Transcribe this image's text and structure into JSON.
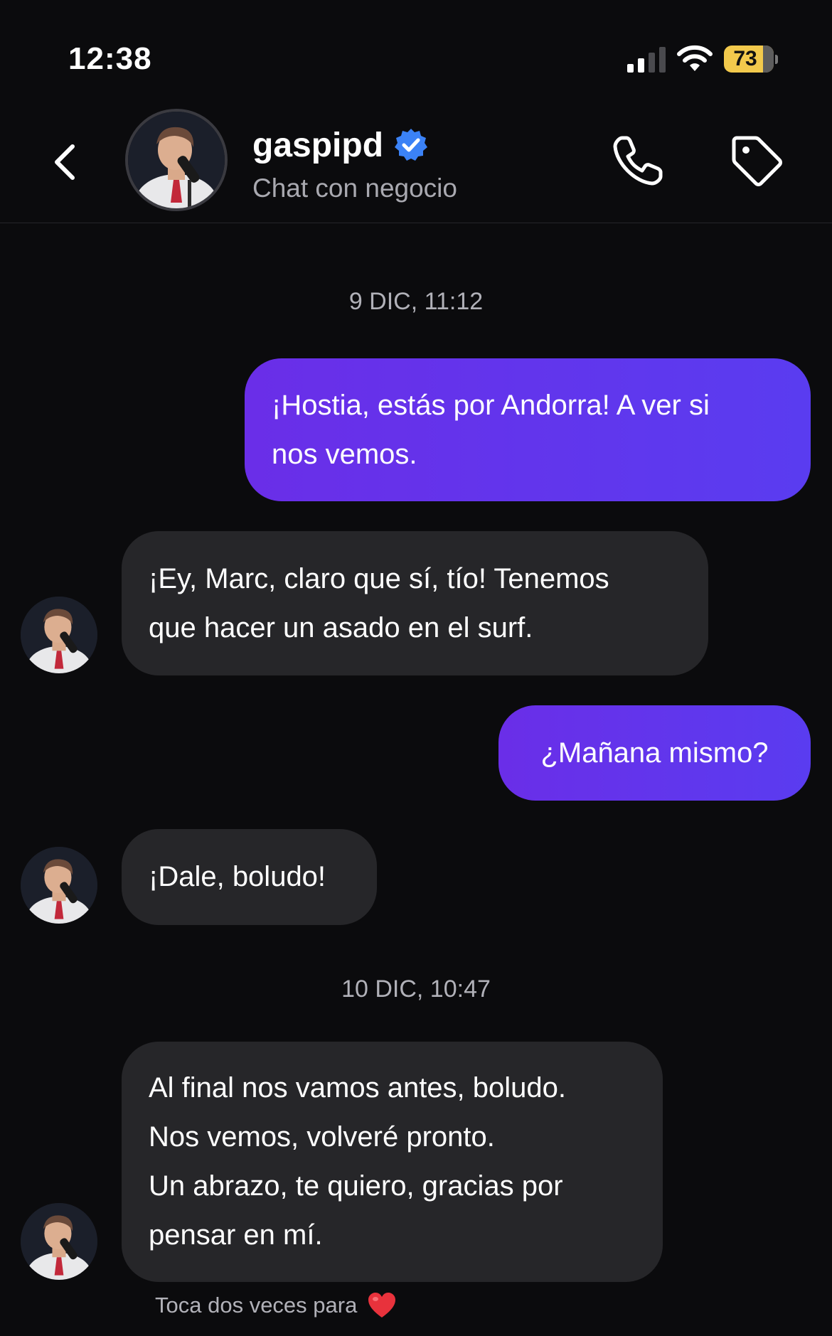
{
  "status_bar": {
    "time": "12:38",
    "battery": "73",
    "battery_level": 0.73
  },
  "header": {
    "contact_name": "gaspipd",
    "subtitle": "Chat con negocio",
    "verified": true,
    "icons": [
      "chevron-left-icon",
      "verified-badge-icon",
      "phone-icon",
      "tag-icon"
    ]
  },
  "chat": {
    "timestamps": [
      "9 DIC, 11:12",
      "10 DIC, 10:47"
    ],
    "messages": [
      {
        "from": "me",
        "text": "¡Hostia, estás por Andorra! A ver si\nnos vemos."
      },
      {
        "from": "gaspipd",
        "text": "¡Ey, Marc, claro que sí, tío! Tenemos\nque hacer un asado en el surf."
      },
      {
        "from": "me",
        "text": "¿Mañana mismo?"
      },
      {
        "from": "gaspipd",
        "text": "¡Dale, boludo!"
      },
      {
        "from": "gaspipd",
        "text": "Al final nos vamos antes, boludo.\nNos vemos, volveré pronto.\nUn abrazo, te quiero, gracias por\npensar en mí."
      }
    ],
    "hint": "Toca dos veces para",
    "hint_icon": "heart-icon"
  },
  "colors": {
    "background": "#0b0b0d",
    "sent_bubble": "#5e38ee",
    "received_bubble": "#262629",
    "verified": "#3b82f6",
    "battery": "#f2c94c",
    "heart": "#e8323c"
  }
}
